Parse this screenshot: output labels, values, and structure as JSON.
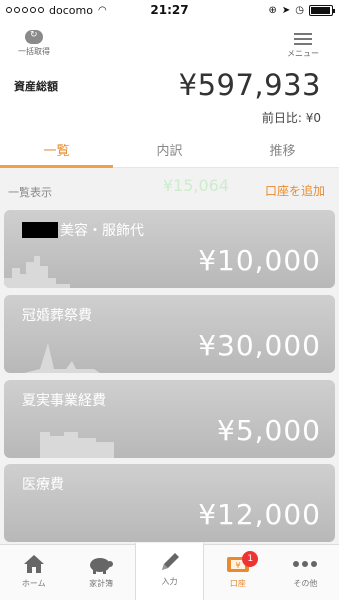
{
  "status": {
    "carrier": "docomo",
    "time": "21:27"
  },
  "header": {
    "fetch_label": "一括取得",
    "menu_label": "メニュー",
    "asset_label": "資産総額",
    "asset_value": "¥597,933",
    "diff": "前日比: ¥0"
  },
  "tabs": [
    "一覧",
    "内訳",
    "推移"
  ],
  "list": {
    "title": "一覧表示",
    "add_account": "口座を追加",
    "ghost_text": "¥15,064"
  },
  "cards": [
    {
      "name": "美容・服飾代",
      "amount": "¥10,000",
      "redacted_prefix": true
    },
    {
      "name": "冠婚葬祭費",
      "amount": "¥30,000"
    },
    {
      "name": "夏実事業経費",
      "amount": "¥5,000"
    },
    {
      "name": "医療費",
      "amount": "¥12,000"
    }
  ],
  "tabbar": {
    "items": [
      {
        "label": "ホーム",
        "icon": "home-icon"
      },
      {
        "label": "家計簿",
        "icon": "piggy-bank-icon"
      },
      {
        "label": "入力",
        "icon": "pencil-icon"
      },
      {
        "label": "口座",
        "icon": "wallet-icon",
        "badge": "1"
      },
      {
        "label": "その他",
        "icon": "more-icon"
      }
    ]
  },
  "colors": {
    "accent": "#e88b2e",
    "card": "#c4c4c4",
    "badge": "#e33333"
  }
}
